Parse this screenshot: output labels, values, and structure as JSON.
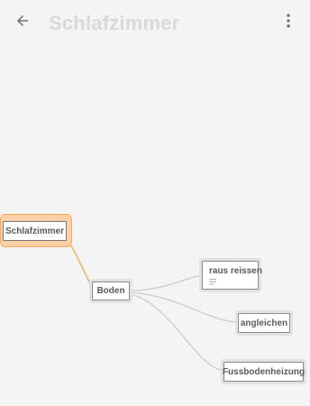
{
  "appbar": {
    "title": "Schlafzimmer",
    "back_icon": "arrow-back-icon",
    "menu_icon": "more-vert-icon"
  },
  "mindmap": {
    "root": {
      "label": "Schlafzimmer"
    },
    "nodes": [
      {
        "label": "Boden"
      },
      {
        "label": "raus reissen",
        "has_note": true
      },
      {
        "label": "angleichen"
      },
      {
        "label": "Fussbodenheizung"
      }
    ]
  },
  "colors": {
    "background": "#f4f4f4",
    "title": "#d9d9d9",
    "root_highlight": "#fad1a7",
    "root_edge": "#f4ad63",
    "child_edge": "#cccccc",
    "node_border": "#8a8a8a"
  }
}
